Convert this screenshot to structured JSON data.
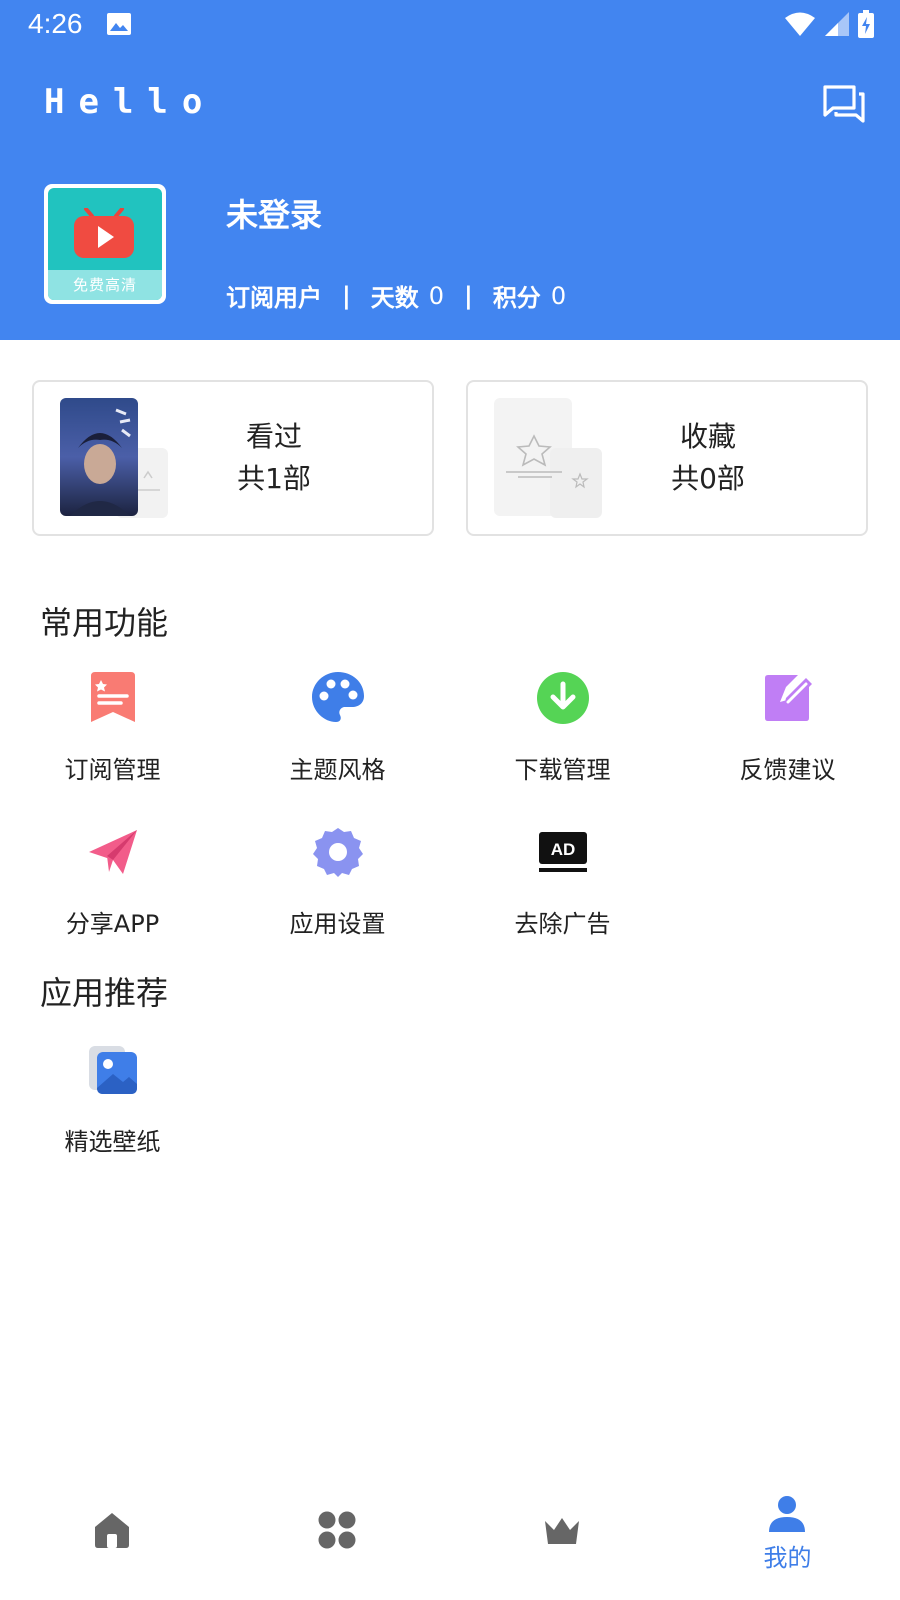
{
  "status_bar": {
    "time": "4:26",
    "icons": [
      "image-icon",
      "wifi-icon",
      "signal-icon",
      "battery-charging-icon"
    ]
  },
  "header": {
    "title": "Hello",
    "message_icon": "chat-bubbles-icon",
    "avatar_caption": "免费高清",
    "user_name": "未登录",
    "stats": {
      "subscribe_label": "订阅用户",
      "days_label": "天数",
      "days_value": "0",
      "points_label": "积分",
      "points_value": "0"
    }
  },
  "cards": {
    "watched": {
      "title": "看过",
      "count": "共1部"
    },
    "favorites": {
      "title": "收藏",
      "count": "共0部"
    }
  },
  "common_functions": {
    "title": "常用功能",
    "items": [
      {
        "label": "订阅管理",
        "icon": "subscription-icon",
        "color": "#f97b73"
      },
      {
        "label": "主题风格",
        "icon": "palette-icon",
        "color": "#3f7ee8"
      },
      {
        "label": "下载管理",
        "icon": "download-icon",
        "color": "#55d455"
      },
      {
        "label": "反馈建议",
        "icon": "feedback-edit-icon",
        "color": "#c07ef5"
      },
      {
        "label": "分享APP",
        "icon": "paper-plane-icon",
        "color": "#f25c8a"
      },
      {
        "label": "应用设置",
        "icon": "settings-gear-icon",
        "color": "#8a93f0"
      },
      {
        "label": "去除广告",
        "icon": "ad-icon",
        "color": "#111111"
      }
    ]
  },
  "recommended": {
    "title": "应用推荐",
    "items": [
      {
        "label": "精选壁纸",
        "icon": "wallpaper-icon",
        "color": "#3f7ee8"
      }
    ]
  },
  "bottom_nav": {
    "items": [
      {
        "icon": "home-icon",
        "label": ""
      },
      {
        "icon": "apps-grid-icon",
        "label": ""
      },
      {
        "icon": "crown-icon",
        "label": ""
      },
      {
        "icon": "person-icon",
        "label": "我的",
        "active": true
      }
    ],
    "inactive_color": "#666666",
    "active_color": "#3f7ee8"
  },
  "colors": {
    "header_bg": "#4285f0"
  }
}
